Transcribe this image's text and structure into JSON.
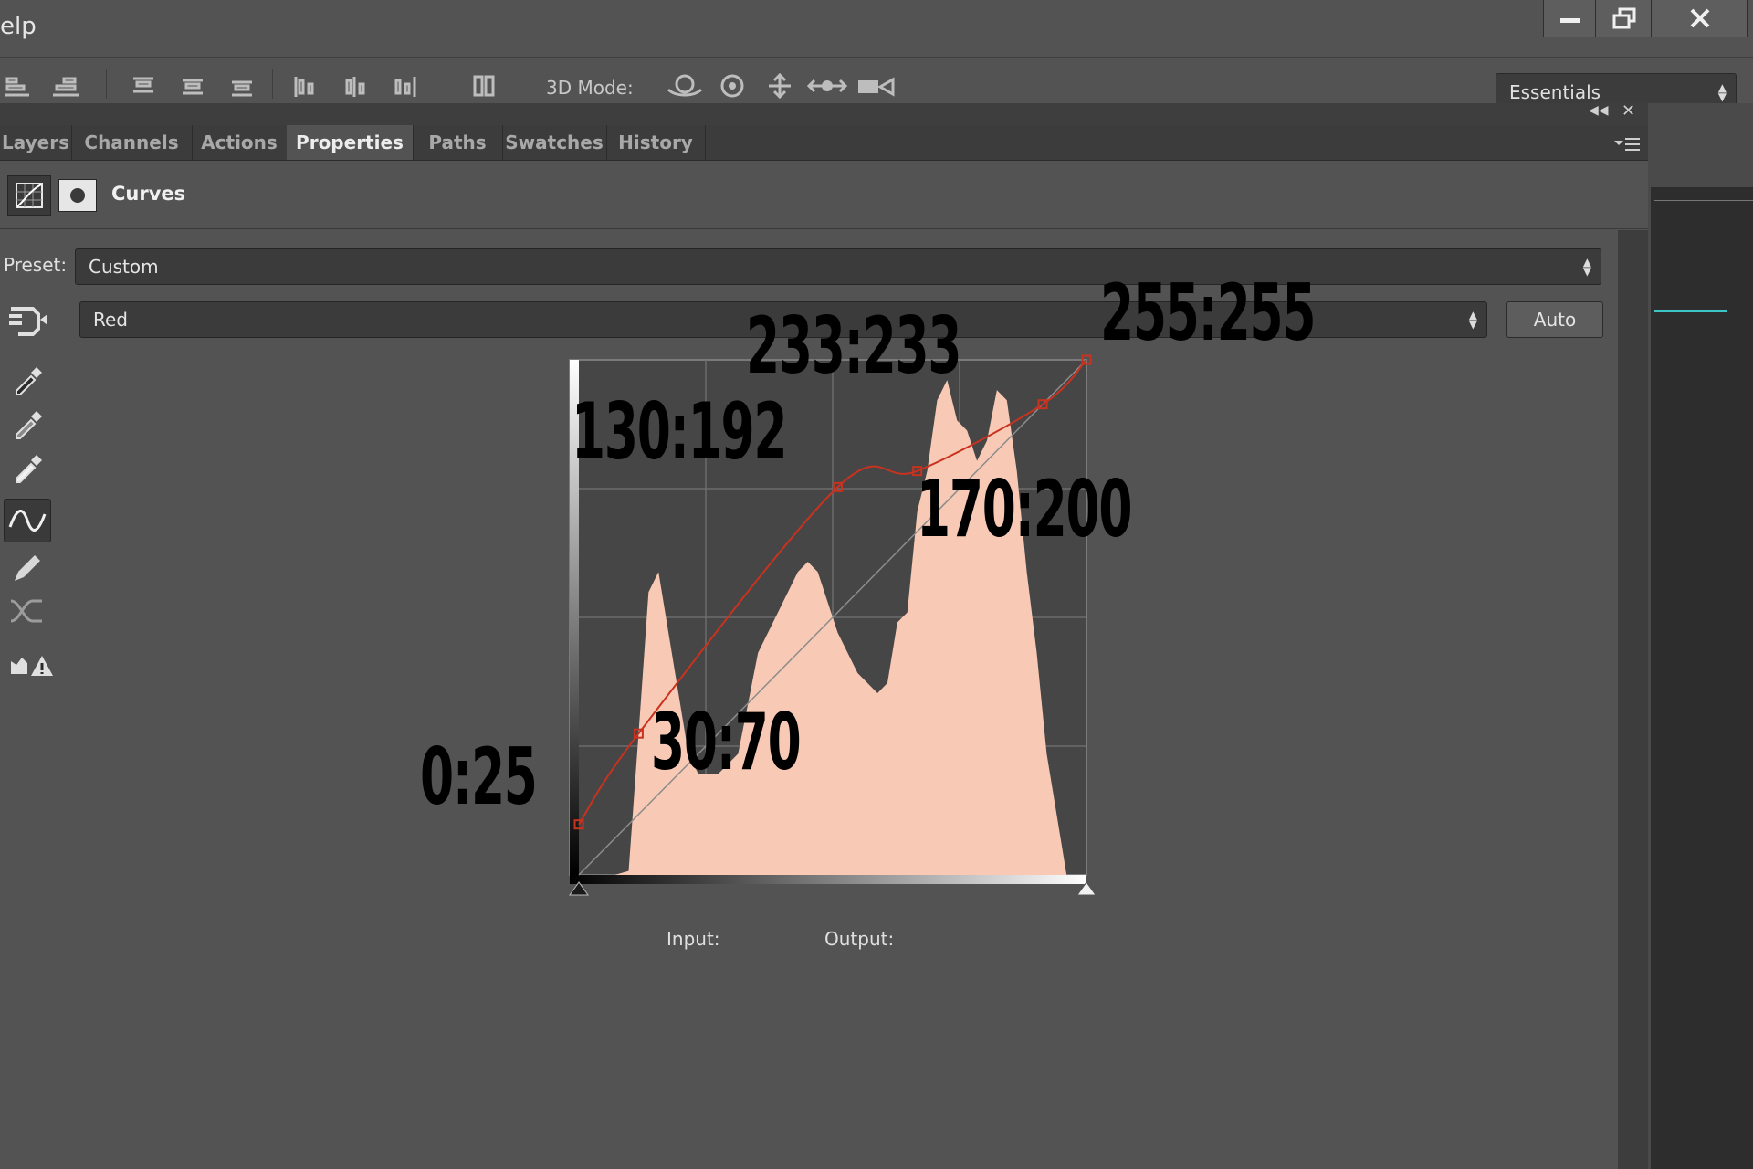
{
  "menu": {
    "partial_label": "elp"
  },
  "window_controls": [
    {
      "name": "minimize",
      "icon": "minimize-icon"
    },
    {
      "name": "restore",
      "icon": "restore-icon"
    },
    {
      "name": "close",
      "icon": "close-icon"
    }
  ],
  "options_bar": {
    "mode_3d_label": "3D Mode:",
    "workspace": "Essentials"
  },
  "panel": {
    "tabs": [
      {
        "label": "Layers",
        "active": false
      },
      {
        "label": "Channels",
        "active": false
      },
      {
        "label": "Actions",
        "active": false
      },
      {
        "label": "Properties",
        "active": true
      },
      {
        "label": "Paths",
        "active": false
      },
      {
        "label": "Swatches",
        "active": false
      },
      {
        "label": "History",
        "active": false
      }
    ],
    "title": "Curves",
    "preset_label": "Preset:",
    "preset_value": "Custom",
    "channel_value": "Red",
    "auto_label": "Auto",
    "input_label": "Input:",
    "output_label": "Output:"
  },
  "colors": {
    "curve": "#c9321f",
    "histogram": "#f8c9b4",
    "graph_bg": "#464646",
    "panel_bg": "#535353"
  },
  "chart_data": {
    "type": "line",
    "xlim": [
      0,
      255
    ],
    "ylim": [
      0,
      255
    ],
    "control_points": [
      {
        "x": 0,
        "y": 25
      },
      {
        "x": 30,
        "y": 70
      },
      {
        "x": 130,
        "y": 192
      },
      {
        "x": 170,
        "y": 200
      },
      {
        "x": 233,
        "y": 233
      },
      {
        "x": 255,
        "y": 255
      }
    ],
    "point_labels": [
      "0:25",
      "30:70",
      "130:192",
      "170:200",
      "233:233",
      "255:255"
    ],
    "histogram_x": [
      0,
      10,
      18,
      25,
      30,
      35,
      40,
      45,
      50,
      55,
      60,
      70,
      80,
      90,
      100,
      110,
      115,
      120,
      130,
      140,
      150,
      155,
      160,
      165,
      170,
      175,
      180,
      185,
      190,
      195,
      200,
      205,
      210,
      215,
      220,
      225,
      230,
      235,
      240,
      245,
      250,
      255
    ],
    "histogram_y": [
      0,
      0,
      0,
      2,
      70,
      140,
      150,
      120,
      90,
      60,
      50,
      50,
      60,
      110,
      130,
      150,
      155,
      150,
      120,
      100,
      90,
      95,
      125,
      130,
      180,
      200,
      235,
      245,
      225,
      220,
      205,
      215,
      240,
      235,
      200,
      150,
      110,
      60,
      30,
      0,
      0,
      0
    ]
  }
}
